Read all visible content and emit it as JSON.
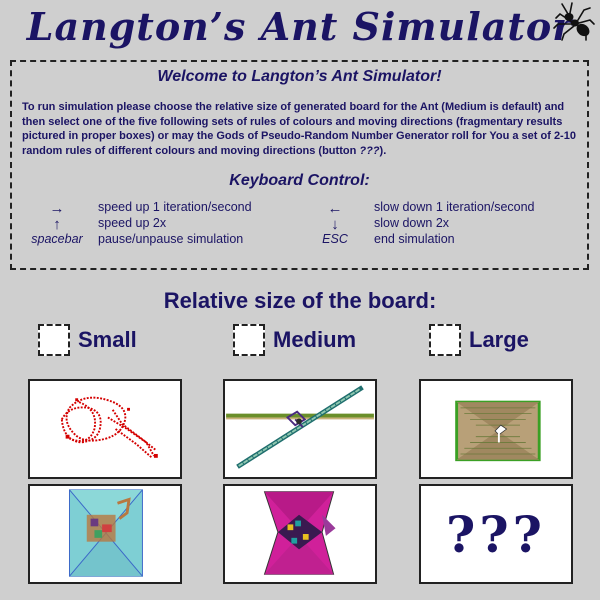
{
  "header": {
    "title": "Langton’s Ant Simulator"
  },
  "info": {
    "welcome": "Welcome to Langton’s Ant Simulator!",
    "intro_text": "To run simulation please choose the relative size of generated board for the Ant (Medium is default) and then select one of the five following sets of rules of colours and moving directions (fragmentary results pictured in proper boxes) or may the Gods of Pseudo-Random Number Generator roll for You a set of 2-10 random rules of different colours and moving directions (button ",
    "intro_em": "???",
    "intro_end": ").",
    "keyboard_title": "Keyboard Control:",
    "keys": [
      {
        "key": "→",
        "desc": "speed up 1 iteration/second"
      },
      {
        "key": "←",
        "desc": "slow down 1 iteration/second"
      },
      {
        "key": "↑",
        "desc": "speed up 2x"
      },
      {
        "key": "↓",
        "desc": "slow down 2x"
      },
      {
        "key": "spacebar",
        "desc": "pause/unpause simulation"
      },
      {
        "key": "ESC",
        "desc": "end simulation"
      }
    ]
  },
  "board_size": {
    "title": "Relative size of the board:",
    "options": [
      "Small",
      "Medium",
      "Large"
    ]
  },
  "random_button": {
    "label": "???"
  },
  "colors": {
    "primary": "#1b1464",
    "background": "#cfcfcf"
  },
  "icons": {
    "corner": "ant-icon"
  }
}
